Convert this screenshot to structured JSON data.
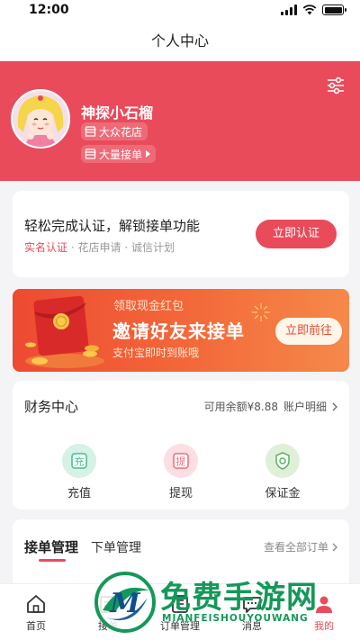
{
  "status_bar": {
    "time": "12:00"
  },
  "nav": {
    "title": "个人中心"
  },
  "profile": {
    "username": "神探小石榴",
    "shop_tag": "大众花店",
    "order_tag": "大量接单"
  },
  "verify": {
    "title": "轻松完成认证，解锁接单功能",
    "steps": [
      "实名认证",
      "花店申请",
      "诚信计划"
    ],
    "button": "立即认证"
  },
  "banner": {
    "top_text": "领取现金红包",
    "title": "邀请好友来接单",
    "subtitle": "支付宝即时到账哦",
    "button": "立即前往"
  },
  "finance": {
    "title": "财务中心",
    "balance_label": "可用余额",
    "balance_value": "¥8.88",
    "detail_link": "账户明细",
    "items": [
      {
        "label": "充值",
        "icon_char": "充",
        "color": "#3fbf8e"
      },
      {
        "label": "提现",
        "icon_char": "提",
        "color": "#ef6b78"
      },
      {
        "label": "保证金",
        "icon_char": "保",
        "color": "#5fae63"
      }
    ]
  },
  "orders": {
    "tab_receive": "接单管理",
    "tab_place": "下单管理",
    "view_all": "查看全部订单"
  },
  "tabbar": {
    "items": [
      {
        "label": "首页",
        "icon": "home-icon"
      },
      {
        "label": "接单",
        "icon": "receive-order-icon"
      },
      {
        "label": "订单管理",
        "icon": "order-list-icon"
      },
      {
        "label": "消息",
        "icon": "message-icon"
      },
      {
        "label": "我的",
        "icon": "profile-icon"
      }
    ]
  },
  "watermark": {
    "logo_letter": "M",
    "title": "免费手游网",
    "subtitle": "MIANFEISHOUYOUWANG"
  },
  "colors": {
    "accent": "#e94b5b",
    "banner": "#ee4a32",
    "watermark": "#14985a"
  }
}
